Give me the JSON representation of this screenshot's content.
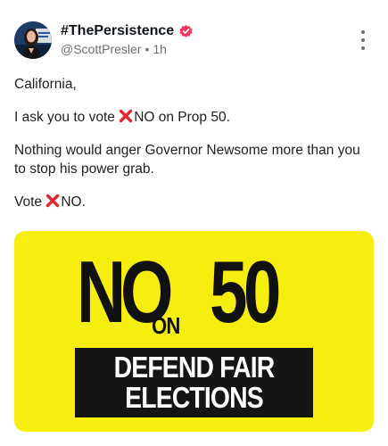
{
  "post": {
    "author": {
      "display_name": "#ThePersistence",
      "handle": "@ScottPresler",
      "separator": "•",
      "time_ago": "1h",
      "verified": true,
      "verified_color": "#f4365e"
    },
    "text": {
      "line1": "California,",
      "line2_pre": "I ask you to vote ",
      "line2_post": "NO on Prop 50.",
      "line3": "Nothing would anger Governor Newsome more than you to stop his power grab.",
      "line4_pre": "Vote ",
      "line4_post": "NO."
    },
    "image": {
      "background_color": "#f7ee10",
      "word_no": "NO",
      "word_on": "ON",
      "number": "50",
      "banner_line1": "DEFEND FAIR",
      "banner_line2": "ELECTIONS"
    }
  },
  "icons": {
    "verified": "verified-badge-icon",
    "x_mark": "cross-mark-icon",
    "more": "more-vertical-icon"
  },
  "colors": {
    "text": "#1d1f22",
    "muted": "#6b6f73",
    "cross": "#e0262e"
  }
}
